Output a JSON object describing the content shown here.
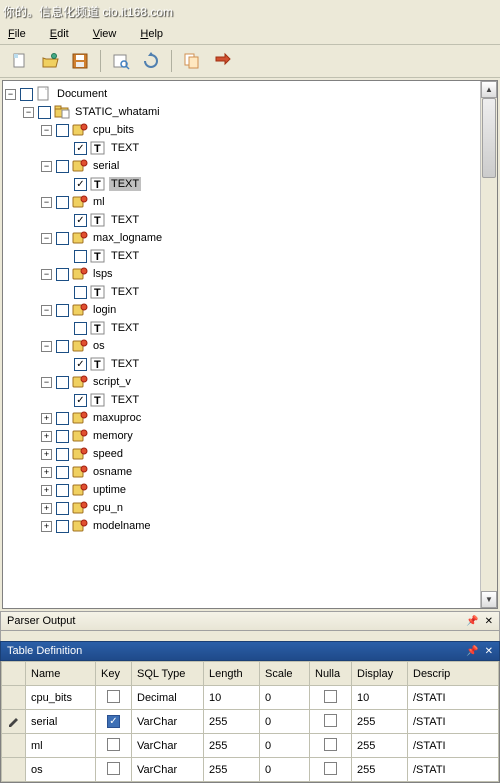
{
  "watermark": "你的。信息化频道 cio.it168.com",
  "menu": {
    "file": "File",
    "edit": "Edit",
    "view": "View",
    "help": "Help"
  },
  "tree": {
    "root": "Document",
    "static": "STATIC_whatami",
    "cpu_bits": "cpu_bits",
    "serial": "serial",
    "ml": "ml",
    "max_logname": "max_logname",
    "lsps": "lsps",
    "login": "login",
    "os": "os",
    "script_v": "script_v",
    "maxuproc": "maxuproc",
    "memory": "memory",
    "speed": "speed",
    "osname": "osname",
    "uptime": "uptime",
    "cpu_n": "cpu_n",
    "modelname": "modelname",
    "text": "TEXT"
  },
  "panels": {
    "parser": "Parser Output",
    "tabledef": "Table Definition"
  },
  "table": {
    "headers": {
      "name": "Name",
      "key": "Key",
      "sqltype": "SQL Type",
      "length": "Length",
      "scale": "Scale",
      "nulla": "Nulla",
      "display": "Display",
      "descrip": "Descrip"
    },
    "rows": [
      {
        "name": "cpu_bits",
        "key": false,
        "sqltype": "Decimal",
        "length": "10",
        "scale": "0",
        "nulla": false,
        "display": "10",
        "descrip": "/STATI"
      },
      {
        "name": "serial",
        "key": true,
        "sqltype": "VarChar",
        "length": "255",
        "scale": "0",
        "nulla": false,
        "display": "255",
        "descrip": "/STATI",
        "edit": true
      },
      {
        "name": "ml",
        "key": false,
        "sqltype": "VarChar",
        "length": "255",
        "scale": "0",
        "nulla": false,
        "display": "255",
        "descrip": "/STATI"
      },
      {
        "name": "os",
        "key": false,
        "sqltype": "VarChar",
        "length": "255",
        "scale": "0",
        "nulla": false,
        "display": "255",
        "descrip": "/STATI"
      }
    ]
  },
  "chart_data": null
}
